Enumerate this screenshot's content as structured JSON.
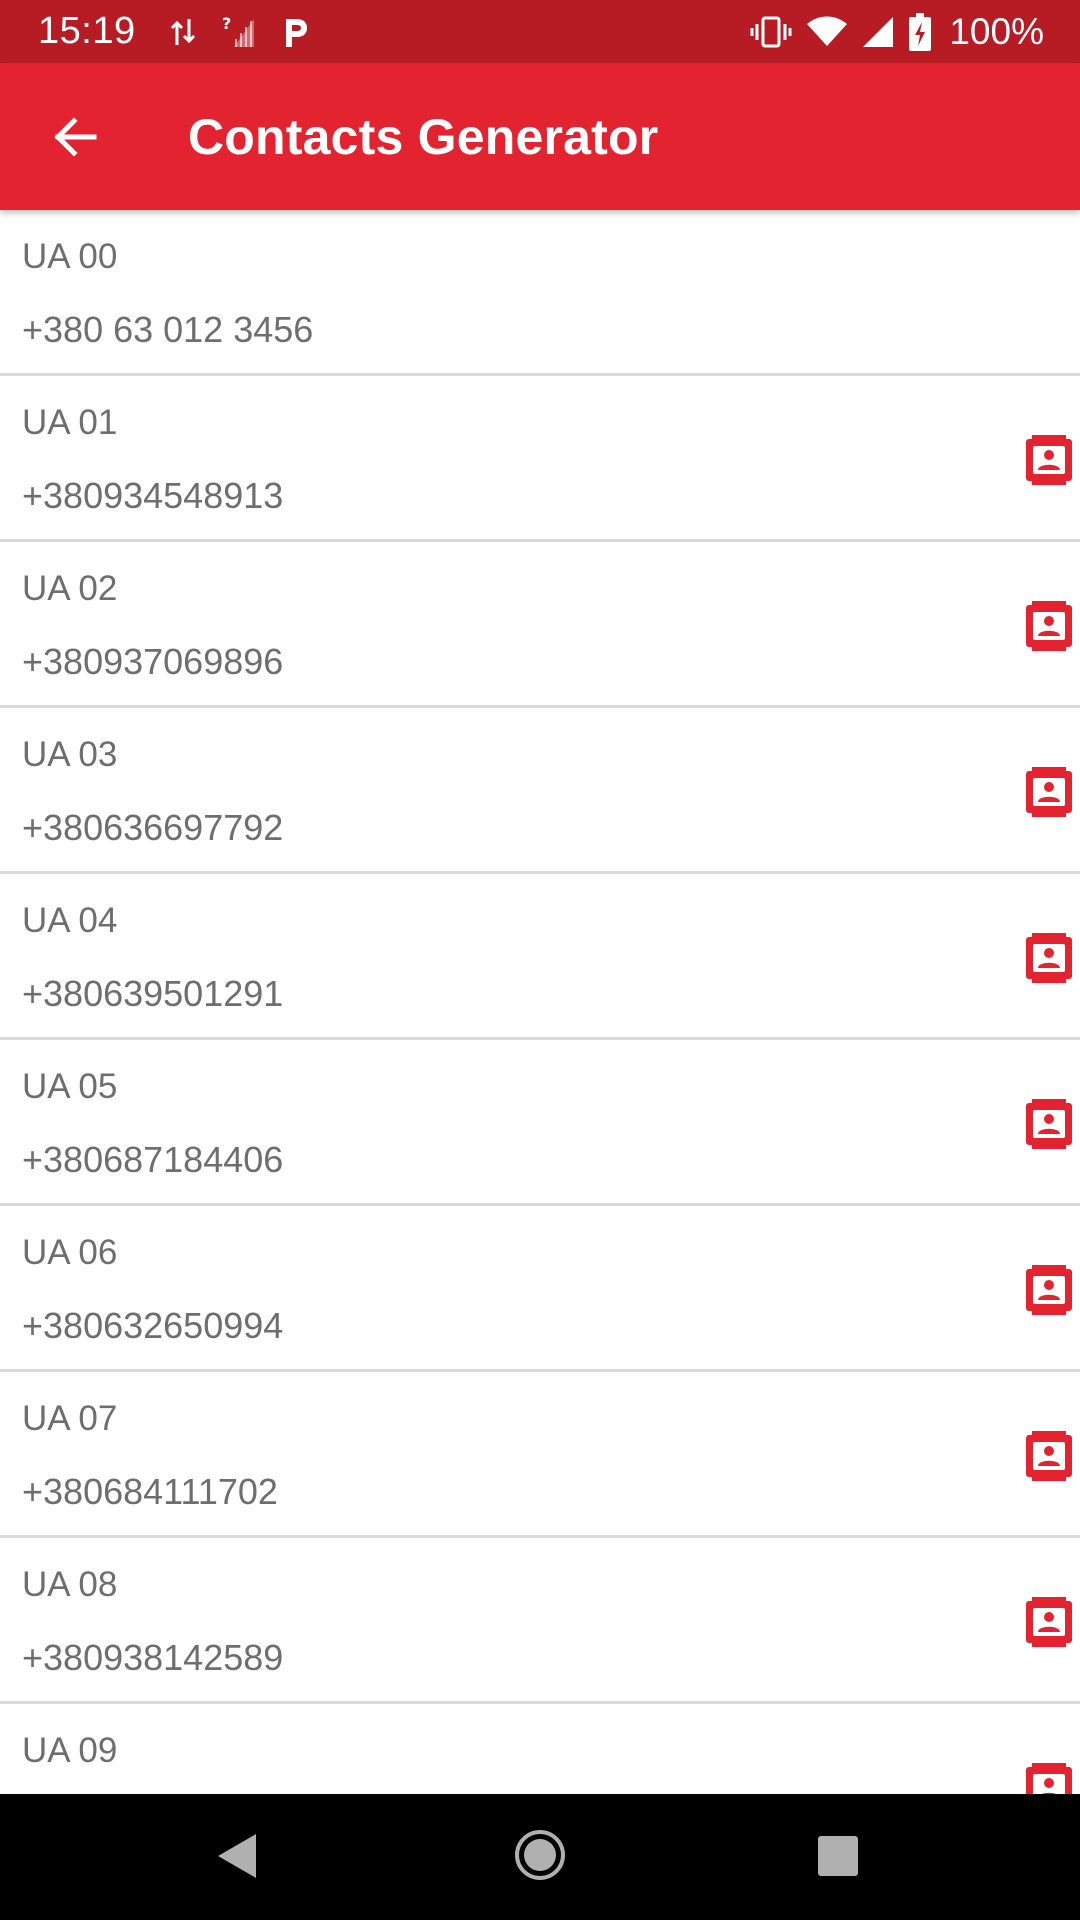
{
  "status_bar": {
    "time": "15:19",
    "battery_text": "100%",
    "icons_left": [
      "data-transfer-icon",
      "no-signal-icon",
      "parking-icon"
    ],
    "icons_right": [
      "vibrate-icon",
      "wifi-icon",
      "signal-icon",
      "battery-charging-icon"
    ]
  },
  "app_bar": {
    "title": "Contacts Generator",
    "back_icon": "arrow-back-icon",
    "background_color": "#e3232f"
  },
  "contacts": [
    {
      "name": "UA 00",
      "phone": "+380 63 012 3456",
      "has_contact_icon": false
    },
    {
      "name": "UA 01",
      "phone": "+380934548913",
      "has_contact_icon": true
    },
    {
      "name": "UA 02",
      "phone": "+380937069896",
      "has_contact_icon": true
    },
    {
      "name": "UA 03",
      "phone": "+380636697792",
      "has_contact_icon": true
    },
    {
      "name": "UA 04",
      "phone": "+380639501291",
      "has_contact_icon": true
    },
    {
      "name": "UA 05",
      "phone": "+380687184406",
      "has_contact_icon": true
    },
    {
      "name": "UA 06",
      "phone": "+380632650994",
      "has_contact_icon": true
    },
    {
      "name": "UA 07",
      "phone": "+380684111702",
      "has_contact_icon": true
    },
    {
      "name": "UA 08",
      "phone": "+380938142589",
      "has_contact_icon": true
    },
    {
      "name": "UA 09",
      "phone": "",
      "has_contact_icon": true
    }
  ],
  "colors": {
    "status_bar": "#b71c24",
    "accent": "#e3232f",
    "text_secondary": "#6e6e6e",
    "divider": "#d9d9d9"
  },
  "nav_bar": {
    "icons": [
      "nav-back-icon",
      "nav-home-icon",
      "nav-recents-icon"
    ]
  }
}
